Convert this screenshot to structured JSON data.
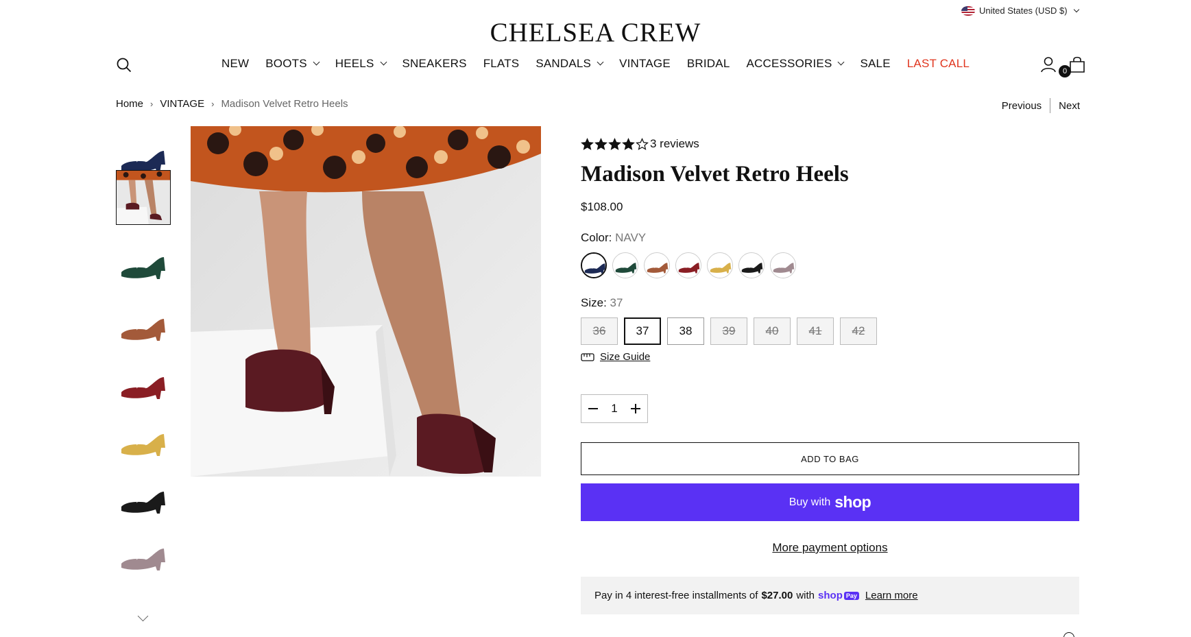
{
  "header": {
    "currency": "United States (USD $)",
    "logo": "CHELSEA CREW",
    "bag_count": "0"
  },
  "nav": [
    {
      "label": "NEW",
      "dropdown": false
    },
    {
      "label": "BOOTS",
      "dropdown": true
    },
    {
      "label": "HEELS",
      "dropdown": true
    },
    {
      "label": "SNEAKERS",
      "dropdown": false
    },
    {
      "label": "FLATS",
      "dropdown": false
    },
    {
      "label": "SANDALS",
      "dropdown": true
    },
    {
      "label": "VINTAGE",
      "dropdown": false
    },
    {
      "label": "BRIDAL",
      "dropdown": false
    },
    {
      "label": "ACCESSORIES",
      "dropdown": true
    },
    {
      "label": "SALE",
      "dropdown": false
    },
    {
      "label": "LAST CALL",
      "dropdown": false,
      "color": "#e0351e"
    }
  ],
  "breadcrumb": {
    "home": "Home",
    "category": "VINTAGE",
    "current": "Madison Velvet Retro Heels"
  },
  "pager": {
    "previous": "Previous",
    "next": "Next"
  },
  "product": {
    "rating": 4.5,
    "reviews": "3 reviews",
    "title": "Madison Velvet Retro Heels",
    "price": "$108.00",
    "color_label": "Color:",
    "color_value": "NAVY",
    "size_label": "Size:",
    "size_value": "37",
    "size_guide": "Size Guide",
    "quantity": "1",
    "add_to_bag": "ADD TO BAG",
    "buy_with": "Buy with",
    "shop": "shop",
    "more_payment": "More payment options"
  },
  "swatches": [
    {
      "name": "navy",
      "color": "#1c2a55",
      "selected": true
    },
    {
      "name": "green",
      "color": "#1f4a3a",
      "selected": false
    },
    {
      "name": "brown",
      "color": "#a35a3a",
      "selected": false
    },
    {
      "name": "red",
      "color": "#8a1e24",
      "selected": false
    },
    {
      "name": "yellow",
      "color": "#d8b04a",
      "selected": false
    },
    {
      "name": "black",
      "color": "#1a1a1a",
      "selected": false
    },
    {
      "name": "mauve",
      "color": "#a08a90",
      "selected": false
    }
  ],
  "sizes": [
    {
      "label": "36",
      "state": "oos"
    },
    {
      "label": "37",
      "state": "active"
    },
    {
      "label": "38",
      "state": "avail"
    },
    {
      "label": "39",
      "state": "oos"
    },
    {
      "label": "40",
      "state": "oos"
    },
    {
      "label": "41",
      "state": "oos"
    },
    {
      "label": "42",
      "state": "oos"
    }
  ],
  "installments": {
    "prefix": "Pay in 4 interest-free installments of",
    "amount": "$27.00",
    "with": "with",
    "shoppay": "shop",
    "shoppay_badge": "Pay",
    "learn_more": "Learn more"
  },
  "thumbnails": [
    {
      "name": "navy",
      "color": "#1c2a55"
    },
    {
      "name": "model-burgundy",
      "color": "#5a1a22"
    },
    {
      "name": "green",
      "color": "#1f4a3a"
    },
    {
      "name": "brown",
      "color": "#a35a3a"
    },
    {
      "name": "red",
      "color": "#8a1e24"
    },
    {
      "name": "yellow",
      "color": "#d8b04a"
    },
    {
      "name": "black",
      "color": "#1a1a1a"
    },
    {
      "name": "mauve",
      "color": "#a08a90"
    }
  ],
  "colors": {
    "shop_pay": "#5a31f4",
    "last_call": "#e0351e"
  }
}
